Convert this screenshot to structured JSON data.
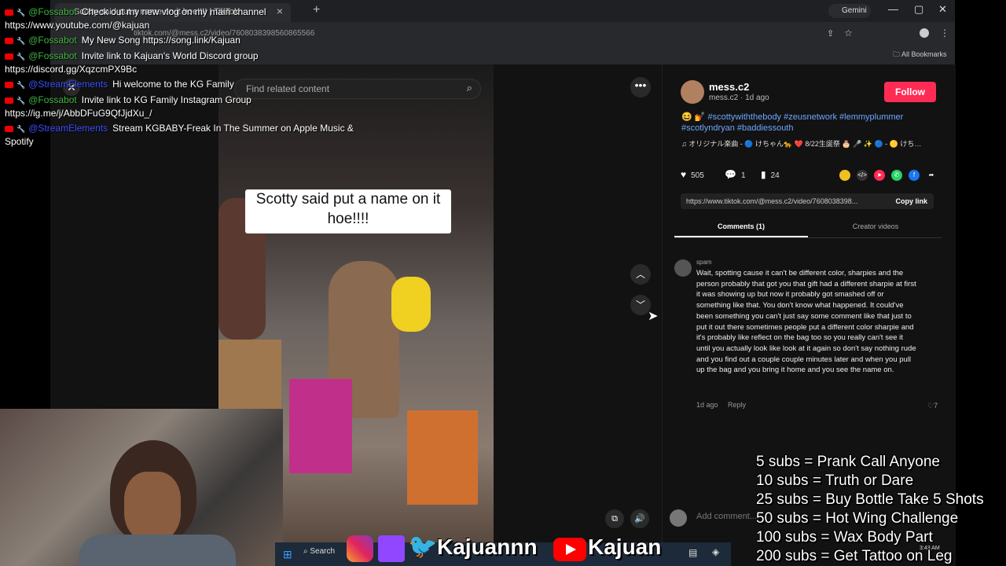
{
  "browser": {
    "tab_title": "Scotty said put a name on it hoe!!!! | TikTok",
    "gemini_label": "Gemini",
    "url": "tiktok.com/@mess.c2/video/7608038398560865566",
    "all_bookmarks": "All Bookmarks"
  },
  "search": {
    "placeholder": "Find related content"
  },
  "video": {
    "caption": "Scotty said put a name on it hoe!!!!"
  },
  "post": {
    "username": "mess.c2",
    "subline": "mess.c2 · 1d ago",
    "follow_label": "Follow",
    "hashtags": "😆 💅 #scottywiththebody #zeusnetwork #lemmyplummer #scotlyndryan #baddiessouth",
    "music": "♫ オリジナル楽曲 - 🔵 けちゃん🐆 ❤️ 8/22生誕祭 🎂 🎤 ✨ 🔵 - 🟡 けち…",
    "likes": "505",
    "comments": "1",
    "saves": "24",
    "link": "https://www.tiktok.com/@mess.c2/video/7608038398...",
    "copy_link": "Copy link"
  },
  "tabs": {
    "comments": "Comments (1)",
    "creator_videos": "Creator videos"
  },
  "comment": {
    "user": "spam",
    "text": "Wait, spotting cause it can't be different color, sharpies and the person probably that got you that gift had a different sharpie at first it was showing up but now it probably got smashed off or something like that. You don't know what happened. It could've been something you can't just say some comment like that just to put it out there sometimes people put a different color sharpie and it's probably like reflect on the bag too so you really can't see it until you actually look like look at it again so don't say nothing rude and you find out a couple couple minutes later and when you pull up the bag and you bring it home and you see the name on.",
    "time": "1d ago",
    "reply": "Reply",
    "likes": "7"
  },
  "add_comment": {
    "placeholder": "Add comment..."
  },
  "chat": [
    {
      "user": "@Fossabot",
      "user_color": "green",
      "msg": "Check out my new vlog on my main channel",
      "extra": "https://www.youtube.com/@kajuan"
    },
    {
      "user": "@Fossabot",
      "user_color": "green",
      "msg": "My New Song https://song.link/Kajuan",
      "extra": ""
    },
    {
      "user": "@Fossabot",
      "user_color": "green",
      "msg": "Invite link to Kajuan's World Discord group",
      "extra": "https://discord.gg/XqzcmPX9Bc"
    },
    {
      "user": "@StreamElements",
      "user_color": "blue",
      "msg": "Hi welcome to the KG Family",
      "extra": ""
    },
    {
      "user": "@Fossabot",
      "user_color": "green",
      "msg": "Invite link to KG Family Instagram Group",
      "extra": "https://ig.me/j/AbbDFuG9QfJjdXu_/"
    },
    {
      "user": "@StreamElements",
      "user_color": "blue",
      "msg": "Stream KGBABY-Freak In The Summer on Apple Music &",
      "extra": "Spotify"
    }
  ],
  "taskbar": {
    "search": "Search",
    "time": "3:43 AM"
  },
  "socials": {
    "handle1": "Kajuannn",
    "handle2": "Kajuan"
  },
  "goals": [
    "5 subs =  Prank Call Anyone",
    "10 subs = Truth or Dare",
    "25 subs = Buy Bottle Take 5 Shots",
    "50 subs = Hot Wing Challenge",
    "100 subs = Wax Body Part",
    "200 subs = Get Tattoo on Leg"
  ]
}
